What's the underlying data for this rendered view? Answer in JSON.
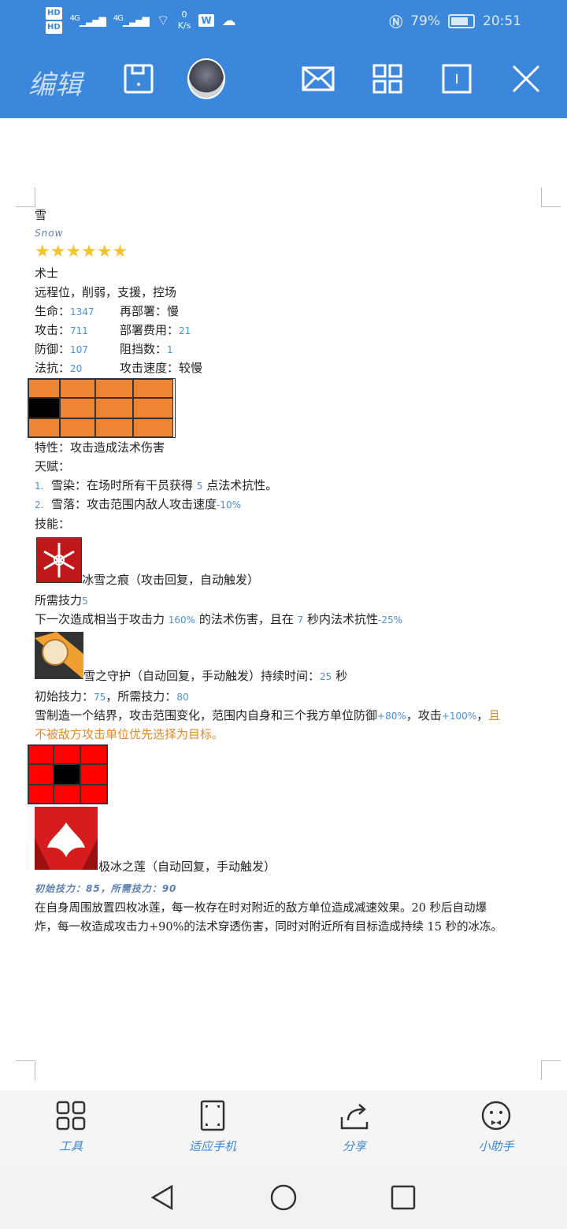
{
  "status": {
    "hd1": "HD",
    "hd2": "HD",
    "net1": "4G",
    "net2": "4G",
    "speed_value": "0",
    "speed_unit": "K/s",
    "battery": "79%",
    "time": "20:51"
  },
  "toolbar": {
    "edit_label": "编辑"
  },
  "doc": {
    "name": "雪",
    "name_en": "Snow",
    "stars": "★★★★★★",
    "class": "术士",
    "tags": "远程位，削弱，支援，控场",
    "hp_label": "生命：",
    "hp": "1347",
    "redeploy_label": "再部署：慢",
    "atk_label": "攻击：",
    "atk": "711",
    "cost_label": "部署费用：",
    "cost": "21",
    "def_label": "防御：",
    "def": "107",
    "block_label": "阻挡数：",
    "block": "1",
    "res_label": "法抗：",
    "res": "20",
    "atkspd_label": "攻击速度：较慢",
    "trait": "特性：攻击造成法术伤害",
    "talent_label": "天赋：",
    "talent1_num": "1.",
    "talent1_a": "雪染：在场时所有干员获得 ",
    "talent1_val": "5",
    "talent1_b": " 点法术抗性。",
    "talent2_num": "2.",
    "talent2_a": "雪落：攻击范围内敌人攻击速度",
    "talent2_val": "-10%",
    "skills_label": "技能：",
    "s1_name": "冰雪之痕（攻击回复，自动触发）",
    "s1_sp_label": "所需技力",
    "s1_sp": "5",
    "s1_a": "下一次造成相当于攻击力 ",
    "s1_v1": "160%",
    "s1_b": " 的法术伤害，且在 ",
    "s1_v2": "7",
    "s1_c": " 秒内法术抗性",
    "s1_v3": "-25%",
    "s2_name": "雪之守护（自动回复，手动触发）持续时间：",
    "s2_dur": "25",
    "s2_sec": " 秒",
    "s2_sp_a": "初始技力：",
    "s2_init": "75",
    "s2_sp_b": "，所需技力：",
    "s2_sp": "80",
    "s2_a": "雪制造一个结界，攻击范围变化，范围内自身和三个我方单位防御",
    "s2_v1": "+80%",
    "s2_b": "，攻击",
    "s2_v2": "+100%",
    "s2_c": "，",
    "s2_orange1": "且",
    "s2_orange2": "不被敌方攻击单位优先选择为目标。",
    "s3_name": "极冰之莲（自动回复，手动触发）",
    "s3_sp": "初始技力：85，所需技力：90",
    "s3_desc1": "在自身周围放置四枚冰莲，每一枚存在时对附近的敌方单位造成减速效果。20 秒后自动爆",
    "s3_desc2": "炸，每一枚造成攻击力+90%的法术穿透伤害，同时对附近所有目标造成持续 15 秒的冰冻。"
  },
  "bottom": {
    "tools": "工具",
    "fit": "适应手机",
    "share": "分享",
    "assistant": "小助手"
  },
  "colors": {
    "accent": "#3b87dc",
    "range_orange": "#ee8534",
    "range_red": "#ff0000"
  }
}
